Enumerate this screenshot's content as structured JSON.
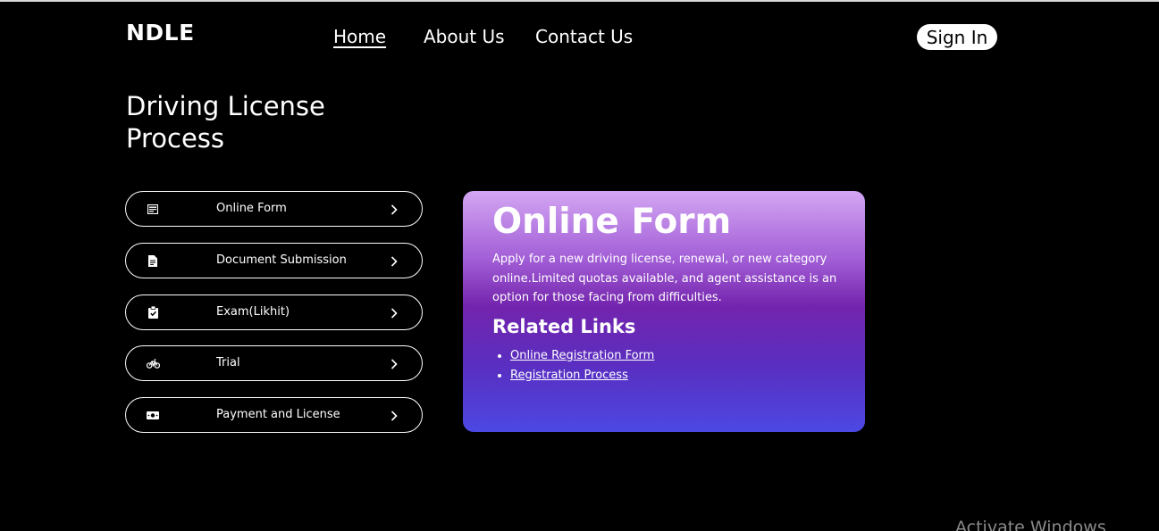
{
  "header": {
    "brand": "NDLE",
    "nav": [
      {
        "label": "Home"
      },
      {
        "label": "About Us"
      },
      {
        "label": "Contact Us"
      }
    ],
    "sign_in_label": "Sign In"
  },
  "main": {
    "title": "Driving License Process",
    "steps": [
      {
        "label": "Online Form",
        "icon": "form-icon"
      },
      {
        "label": "Document Submission",
        "icon": "document-icon"
      },
      {
        "label": "Exam(Likhit)",
        "icon": "clipboard-check-icon"
      },
      {
        "label": "Trial",
        "icon": "bicycle-icon"
      },
      {
        "label": "Payment and License",
        "icon": "money-icon"
      }
    ],
    "card": {
      "heading": "Online Form",
      "description": "Apply for a new driving license, renewal, or new category online.Limited quotas available, and agent assistance is an option for those facing from difficulties.",
      "related_heading": "Related Links",
      "links": [
        {
          "label": "Online Registration Form"
        },
        {
          "label": "Registration Process"
        }
      ]
    }
  },
  "watermark": "Activate Windows",
  "colors": {
    "background": "#000000",
    "card_gradient_top": "#d3a6f2",
    "card_gradient_mid": "#7324ad",
    "card_gradient_bottom": "#4c48e3"
  }
}
